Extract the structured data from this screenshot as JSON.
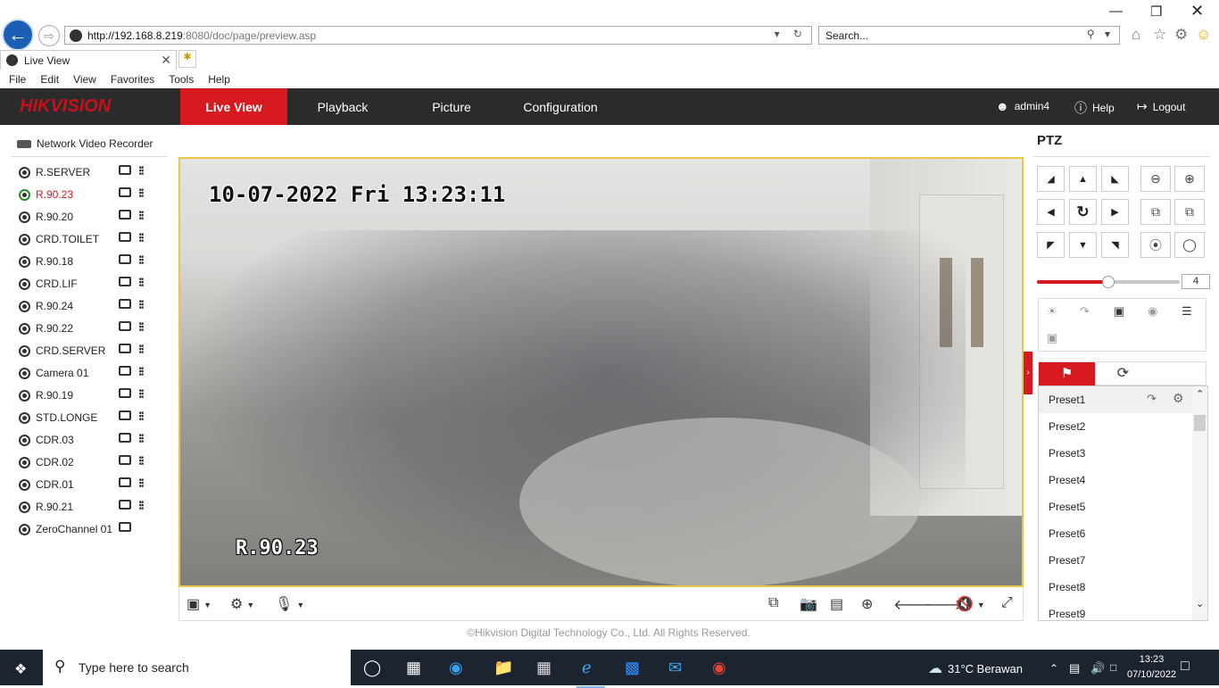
{
  "browser": {
    "url_host": "http://192.168.8.219",
    "url_path": ":8080/doc/page/preview.asp",
    "search_placeholder": "Search...",
    "tab_title": "Live View",
    "menu": [
      "File",
      "Edit",
      "View",
      "Favorites",
      "Tools",
      "Help"
    ]
  },
  "app": {
    "logo_part1": "HIK",
    "logo_part2": "VISION",
    "nav": [
      "Live View",
      "Playback",
      "Picture",
      "Configuration"
    ],
    "active_nav": "Live View",
    "user": "admin4",
    "help": "Help",
    "logout": "Logout"
  },
  "tree": {
    "root": "Network Video Recorder",
    "channels": [
      "R.SERVER",
      "R.90.23",
      "R.90.20",
      "CRD.TOILET",
      "R.90.18",
      "CRD.LIF",
      "R.90.24",
      "R.90.22",
      "CRD.SERVER",
      "Camera 01",
      "R.90.19",
      "STD.LONGE",
      "CDR.03",
      "CDR.02",
      "CDR.01",
      "R.90.21",
      "ZeroChannel 01"
    ],
    "live_channel": "R.90.23"
  },
  "video": {
    "osd_time": "10-07-2022 Fri 13:23:11",
    "osd_name": "R.90.23"
  },
  "footer": {
    "copyright": "©Hikvision Digital Technology Co., Ltd. All Rights Reserved."
  },
  "ptz": {
    "title": "PTZ",
    "speed": "4",
    "speed_level": 0.5,
    "presets": [
      "Preset1",
      "Preset2",
      "Preset3",
      "Preset4",
      "Preset5",
      "Preset6",
      "Preset7",
      "Preset8",
      "Preset9"
    ]
  },
  "taskbar": {
    "search_placeholder": "Type here to search",
    "weather": "31°C  Berawan",
    "time": "13:23",
    "date": "07/10/2022"
  },
  "colors": {
    "brand_red": "#d71920",
    "header_bg": "#2b2b2b"
  }
}
